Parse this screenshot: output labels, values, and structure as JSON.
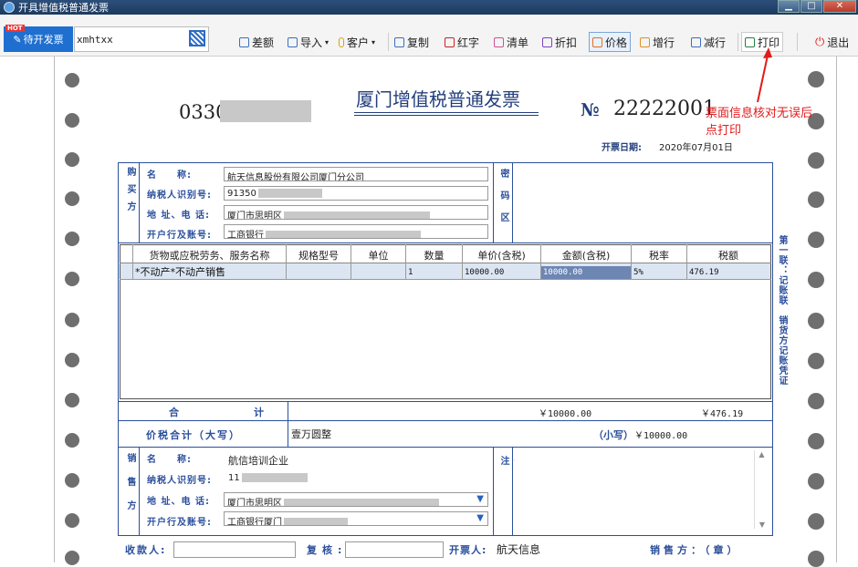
{
  "window": {
    "title": "开具增值税普通发票"
  },
  "toolbar": {
    "hot_badge": "HOT",
    "pending_label": "待开发票",
    "search_value": "xmhtxx",
    "buttons": {
      "diff": "差额",
      "import": "导入",
      "customer": "客户",
      "copy": "复制",
      "red": "红字",
      "list": "清单",
      "discount": "折扣",
      "price": "价格",
      "add_row": "增行",
      "del_row": "减行",
      "print": "打印",
      "exit": "退出"
    }
  },
  "invoice": {
    "code": "0330",
    "title": "厦门增值税普通发票",
    "no_label": "№",
    "number": "22222001",
    "note": "票面信息核对无误后点打印",
    "date_label": "开票日期:",
    "date": "2020年07月01日",
    "buyer": {
      "side_label": "购买方",
      "name_label": "名　　称:",
      "name": "航天信息股份有限公司厦门分公司",
      "tax_id_label": "纳税人识别号:",
      "tax_id": "91350",
      "address_label": "地 址、电 话:",
      "address": "厦门市思明区",
      "bank_label": "开户行及账号:",
      "bank": "工商银行"
    },
    "cipher_label": "密码区",
    "items": {
      "headers": [
        "货物或应税劳务、服务名称",
        "规格型号",
        "单位",
        "数量",
        "单价(含税)",
        "金额(含税)",
        "税率",
        "税额"
      ],
      "rows": [
        {
          "name": "*不动产*不动产销售",
          "spec": "",
          "unit": "",
          "qty": "1",
          "price": "10000.00",
          "amount": "10000.00",
          "rate": "5%",
          "tax": "476.19"
        }
      ]
    },
    "total_label": "合　　计",
    "total_amount": "￥10000.00",
    "total_tax": "￥476.19",
    "total_caps_label": "价税合计（大写）",
    "total_caps": "壹万圆整",
    "total_small_label": "（小写）",
    "total_small": "￥10000.00",
    "seller": {
      "side_label": "销售方",
      "name_label": "名　　称:",
      "name": "航信培训企业",
      "tax_id_label": "纳税人识别号:",
      "tax_id": "11",
      "address_label": "地 址、电 话:",
      "address": "厦门市思明区",
      "bank_label": "开户行及账号:",
      "bank": "工商银行厦门"
    },
    "remarks_label": "备注",
    "side_copy_label": "第一联：记账联　销货方记账凭证",
    "payee_label": "收款人:",
    "reviewer_label": "复核:",
    "drawer_label": "开票人:",
    "drawer": "航天信息",
    "seller_stamp_label": "销售方：（章）"
  }
}
